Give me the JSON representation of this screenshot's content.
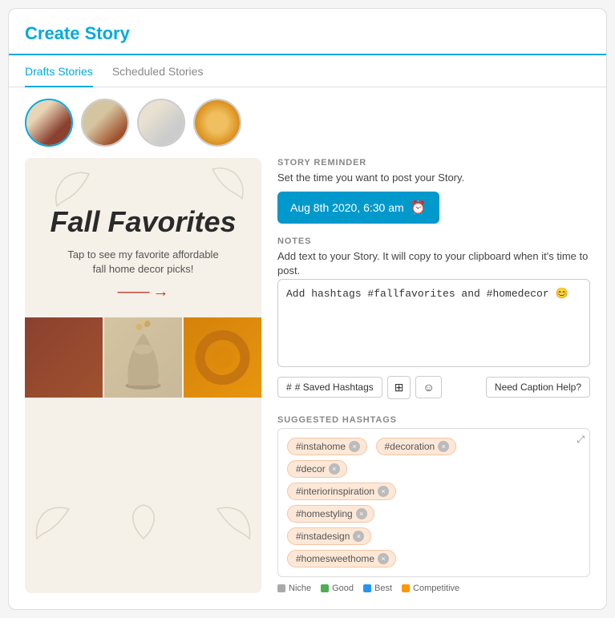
{
  "header": {
    "title": "Create Story"
  },
  "tabs": [
    {
      "label": "Drafts Stories",
      "active": true
    },
    {
      "label": "Scheduled Stories",
      "active": false
    }
  ],
  "thumbnails": [
    {
      "id": 1,
      "alt": "Fall Favorites story thumbnail",
      "style": "1"
    },
    {
      "id": 2,
      "alt": "Rust blanket thumbnail",
      "style": "2"
    },
    {
      "id": 3,
      "alt": "Vase thumbnail",
      "style": "3"
    },
    {
      "id": 4,
      "alt": "Wreath thumbnail",
      "style": "4"
    }
  ],
  "story_preview": {
    "title": "Fall Favorites",
    "subtitle": "Tap to see my favorite affordable\nfall home decor picks!",
    "arrow": "→"
  },
  "reminder": {
    "section_label": "STORY REMINDER",
    "description": "Set the time you want to post your Story.",
    "button_label": "Aug 8th 2020, 6:30 am",
    "clock_icon": "⏰"
  },
  "notes": {
    "section_label": "NOTES",
    "description": "Add text to your Story. It will copy to your clipboard when it's time to post.",
    "textarea_content": "Add hashtags #fallfavorites and #homedecor 😊",
    "toolbar": {
      "hashtag_btn": "# Saved Hashtags",
      "image_icon": "🖼",
      "emoji_icon": "😊",
      "caption_btn": "Need Caption Help?"
    }
  },
  "suggested_hashtags": {
    "section_label": "SUGGESTED HASHTAGS",
    "tags": [
      "#instahome",
      "#decoration",
      "#decor",
      "#interiorinspiration",
      "#homestyling",
      "#instadesign",
      "#homesweethome"
    ]
  },
  "legend": {
    "items": [
      {
        "label": "Niche",
        "color": "#aaa"
      },
      {
        "label": "Good",
        "color": "#4caf50"
      },
      {
        "label": "Best",
        "color": "#2196f3"
      },
      {
        "label": "Competitive",
        "color": "#ff9800"
      }
    ]
  }
}
